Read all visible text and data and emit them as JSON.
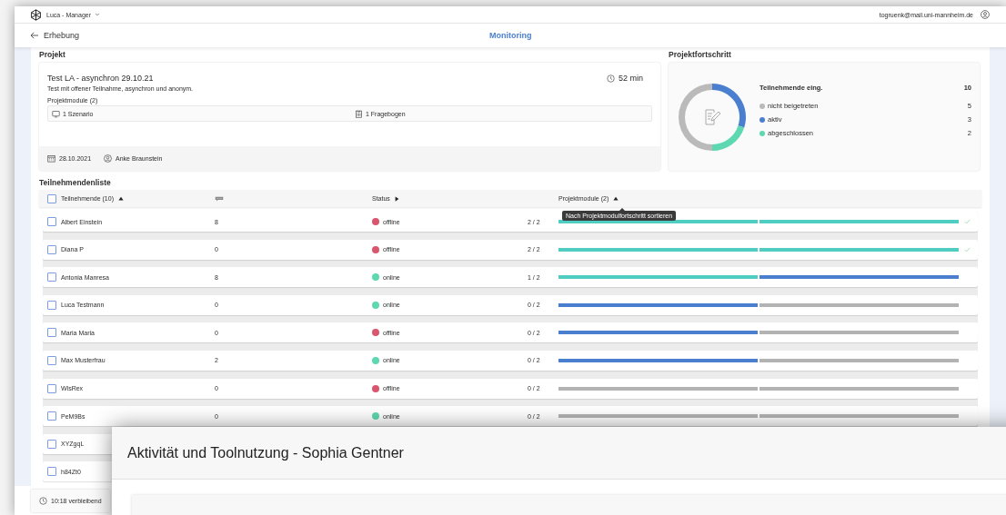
{
  "app": {
    "name": "Luca - Manager",
    "user_email": "togruenk@mail.uni-mannheim.de"
  },
  "nav": {
    "back": "Erhebung",
    "title": "Monitoring"
  },
  "project": {
    "heading": "Projekt",
    "title": "Test LA - asynchron 29.10.21",
    "duration": "52 min",
    "description": "Test mit offener Teilnahme, asynchron und anonym.",
    "modules_label": "Projektmodule (2)",
    "modules": [
      {
        "kind": "scenario",
        "label": "1 Szenario"
      },
      {
        "kind": "questionnaire",
        "label": "1 Fragebogen"
      }
    ],
    "date": "28.10.2021",
    "author": "Anke Braunstein"
  },
  "progress": {
    "heading": "Projektfortschritt",
    "total_label": "Teilnehmende eing.",
    "total": "10",
    "legend": [
      {
        "label": "nicht beigetreten",
        "count": "5",
        "color": "#bababa"
      },
      {
        "label": "aktiv",
        "count": "3",
        "color": "#4a7fd0"
      },
      {
        "label": "abgeschlossen",
        "count": "2",
        "color": "#5dd8b0"
      }
    ]
  },
  "participants": {
    "heading": "Teilnehmendenliste",
    "header_checked": false,
    "columns": [
      {
        "kind": "name",
        "label": "Teilnehmende (10)",
        "sorted": true
      },
      {
        "kind": "comments"
      },
      {
        "kind": "status",
        "label": "Status",
        "sorted": false
      },
      {
        "kind": "modules",
        "label": "Projektmodule (2)",
        "sorted": true
      }
    ],
    "tooltip": "Nach Projektmodulfortschritt sortieren",
    "rows": [
      {
        "name": "Albert Einstein",
        "checked": false,
        "count": "8",
        "status": "offline",
        "online": false,
        "progress": "2 / 2",
        "modules": [
          {
            "kind": "done"
          },
          {
            "kind": "done"
          }
        ],
        "completed": true
      },
      {
        "name": "Diana P",
        "checked": false,
        "count": "0",
        "status": "offline",
        "online": false,
        "progress": "2 / 2",
        "modules": [
          {
            "kind": "done"
          },
          {
            "kind": "done"
          }
        ],
        "completed": true
      },
      {
        "name": "Antonia Manresa",
        "checked": false,
        "count": "8",
        "status": "online",
        "online": true,
        "progress": "1 / 2",
        "modules": [
          {
            "kind": "done"
          },
          {
            "kind": "active"
          }
        ],
        "completed": false
      },
      {
        "name": "Luca Testmann",
        "checked": false,
        "count": "0",
        "status": "online",
        "online": true,
        "progress": "0 / 2",
        "modules": [
          {
            "kind": "active"
          },
          {
            "kind": "open"
          }
        ],
        "completed": false
      },
      {
        "name": "Maria Maria",
        "checked": false,
        "count": "0",
        "status": "offline",
        "online": false,
        "progress": "0 / 2",
        "modules": [
          {
            "kind": "active"
          },
          {
            "kind": "open"
          }
        ],
        "completed": false
      },
      {
        "name": "Max Musterfrau",
        "checked": false,
        "count": "2",
        "status": "online",
        "online": true,
        "progress": "0 / 2",
        "modules": [
          {
            "kind": "active"
          },
          {
            "kind": "open"
          }
        ],
        "completed": false
      },
      {
        "name": "WlsRex",
        "checked": false,
        "count": "0",
        "status": "offline",
        "online": false,
        "progress": "0 / 2",
        "modules": [
          {
            "kind": "open"
          },
          {
            "kind": "open"
          }
        ],
        "completed": false
      },
      {
        "name": "PeM9Bs",
        "checked": false,
        "count": "0",
        "status": "online",
        "online": true,
        "progress": "0 / 2",
        "modules": [
          {
            "kind": "open"
          },
          {
            "kind": "open"
          }
        ],
        "completed": false
      },
      {
        "name": "XYZgqL",
        "checked": false
      },
      {
        "name": "h84Zt0",
        "checked": false
      }
    ]
  },
  "footer": {
    "remaining": "10:18 verbleibend"
  },
  "dialog": {
    "title": "Aktivität und Toolnutzung - Sophia Gentner"
  }
}
